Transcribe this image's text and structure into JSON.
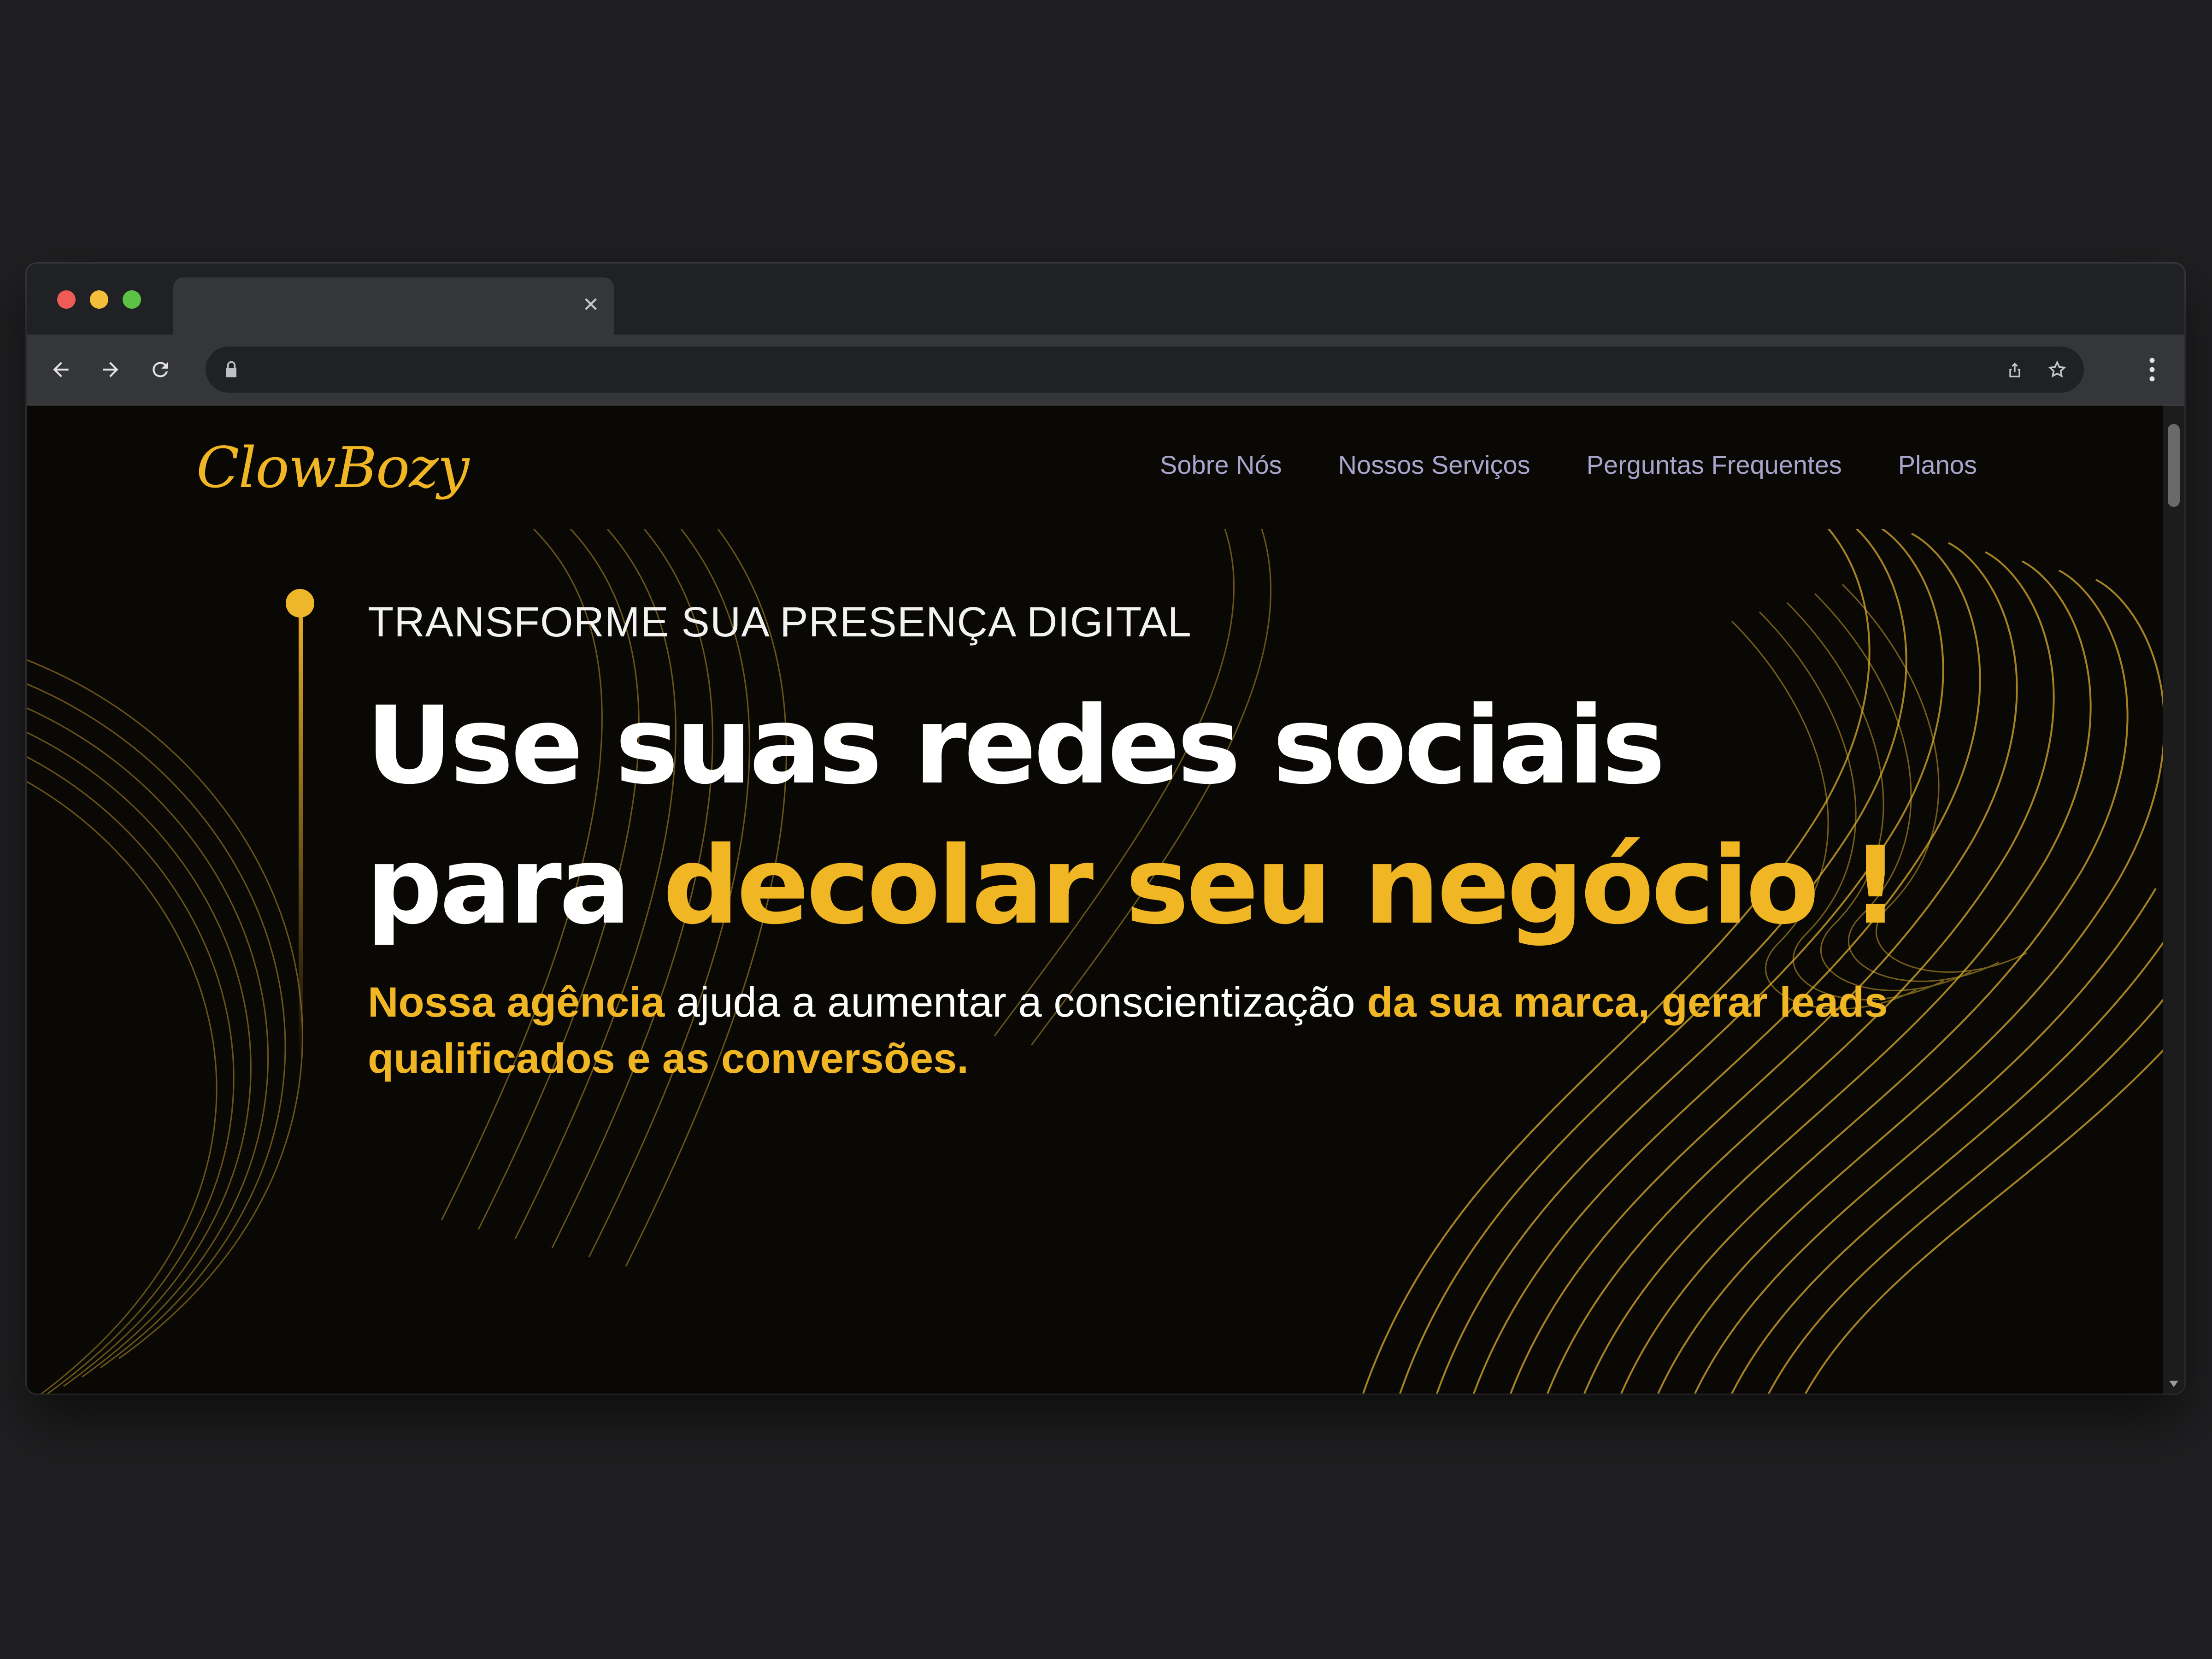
{
  "browser": {
    "tab_title": "",
    "tab_close": "✕",
    "url": "",
    "icons": {
      "back": "arrow-left",
      "forward": "arrow-right",
      "reload": "reload",
      "lock": "lock",
      "share": "share",
      "bookmark": "star",
      "menu": "kebab-menu"
    }
  },
  "site": {
    "logo_text": "ClowBozy",
    "nav": [
      {
        "label": "Sobre Nós"
      },
      {
        "label": "Nossos Serviços"
      },
      {
        "label": "Perguntas Frequentes"
      },
      {
        "label": "Planos"
      }
    ],
    "hero": {
      "eyebrow": "TRANSFORME SUA PRESENÇA DIGITAL",
      "headline_line1": "Use suas redes sociais",
      "headline_line2_white": "para ",
      "headline_line2_accent": "decolar seu negócio !",
      "sub_part1_accent": "Nossa agência",
      "sub_part2": " ajuda a aumentar a conscientização ",
      "sub_part3_accent": "da sua marca, gerar leads qualificados e as conversões."
    }
  },
  "colors": {
    "background": "#1f1f21",
    "page": "#0a0805",
    "accent": "#f1b624",
    "nav_text": "#a9a4cc"
  }
}
